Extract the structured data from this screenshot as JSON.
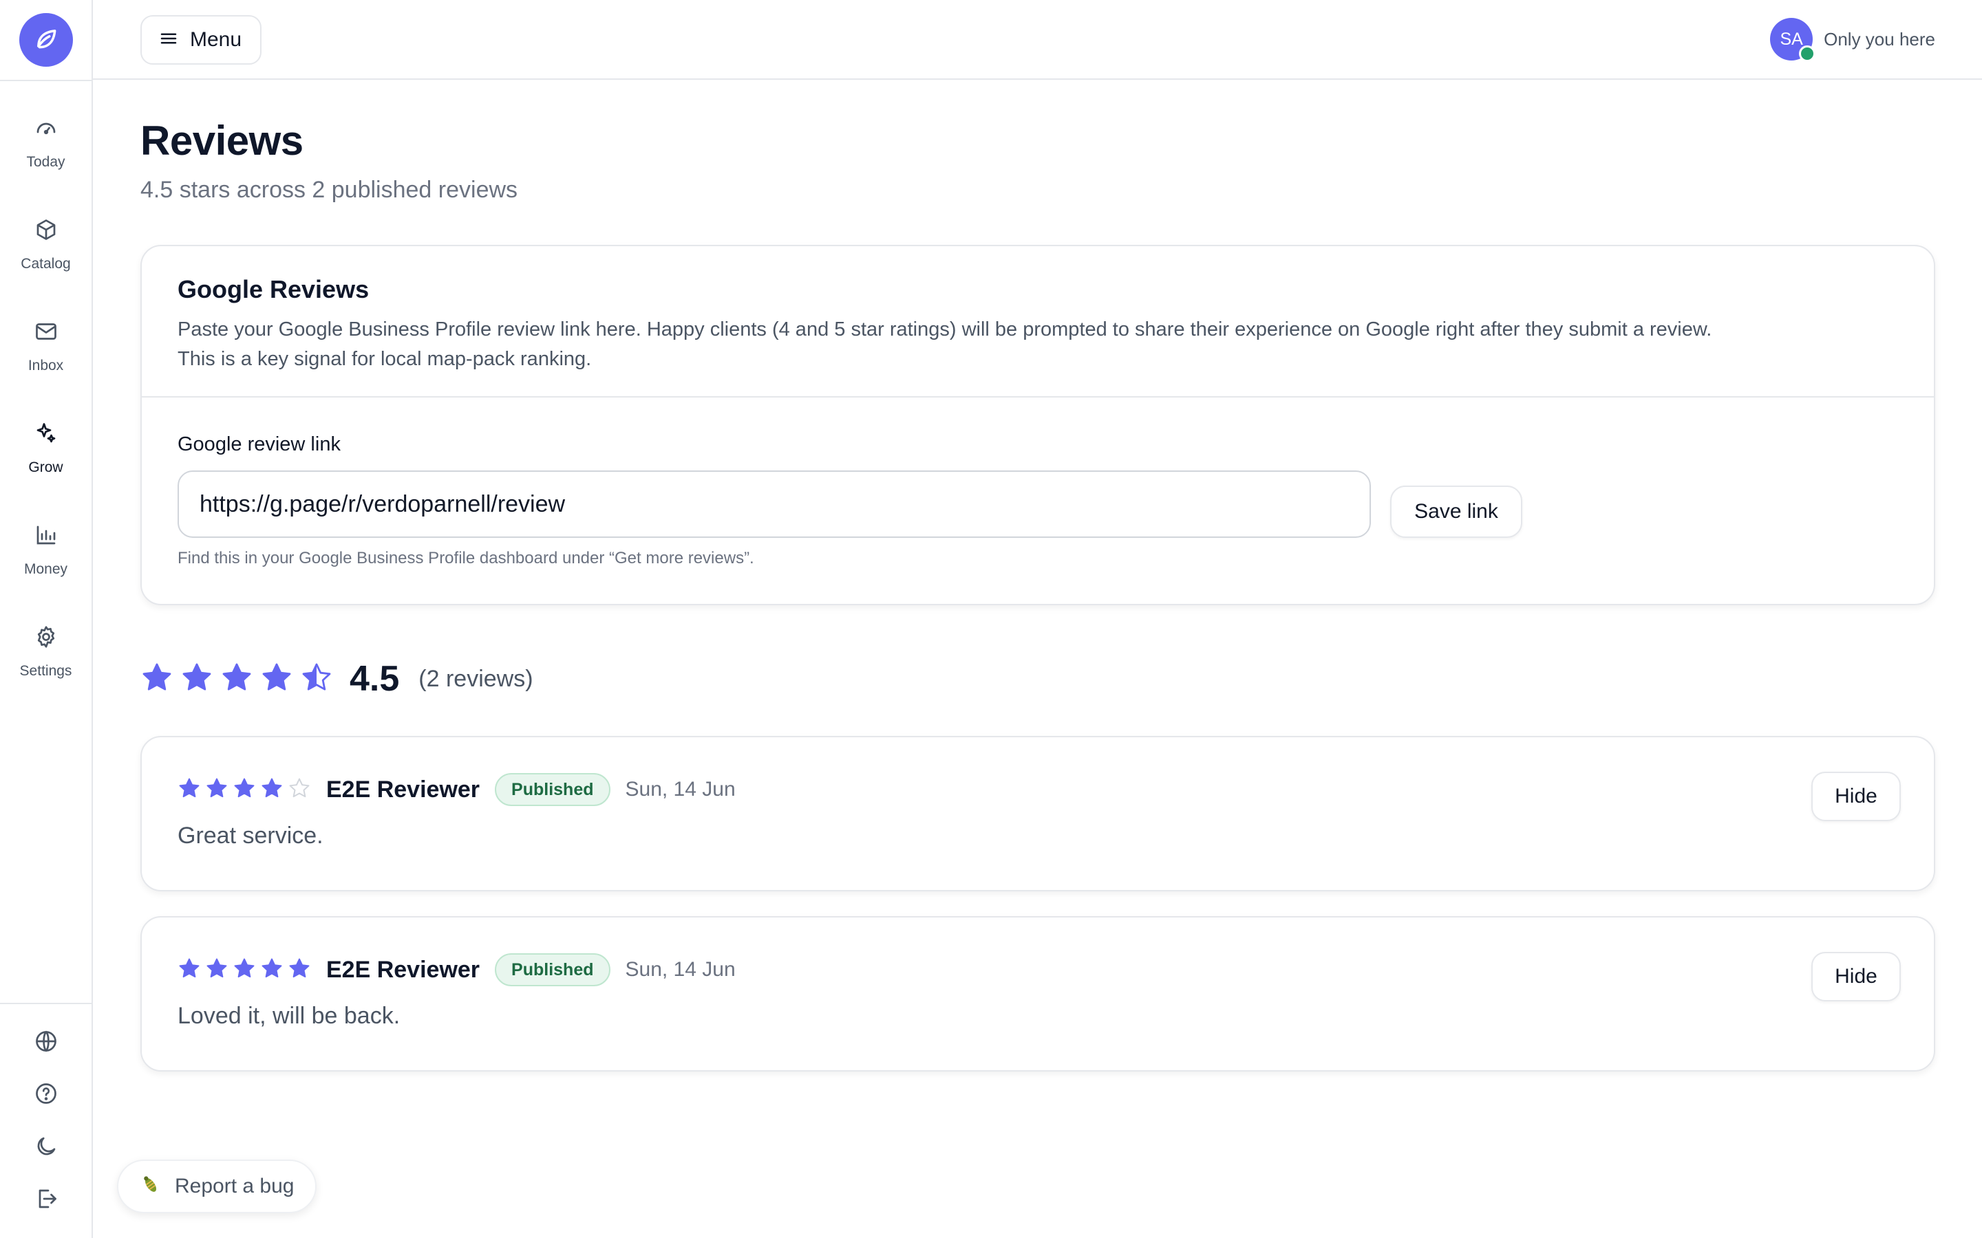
{
  "app": {
    "logo_icon": "leaf-icon",
    "accent_color": "#6366f1",
    "success_color": "#22a06b"
  },
  "sidebar": {
    "items": [
      {
        "label": "Today",
        "icon": "gauge-icon"
      },
      {
        "label": "Catalog",
        "icon": "box-icon"
      },
      {
        "label": "Inbox",
        "icon": "mail-icon"
      },
      {
        "label": "Grow",
        "icon": "sparkles-icon",
        "active": true
      },
      {
        "label": "Money",
        "icon": "bar-chart-icon"
      },
      {
        "label": "Settings",
        "icon": "gear-icon"
      }
    ],
    "bottom_icons": [
      "globe-icon",
      "help-icon",
      "moon-icon",
      "logout-icon"
    ]
  },
  "topbar": {
    "menu_label": "Menu",
    "user_initials": "SA",
    "presence_text": "Only you here"
  },
  "page": {
    "title": "Reviews",
    "subtitle": "4.5 stars across 2 published reviews"
  },
  "google": {
    "title": "Google Reviews",
    "description_line1": "Paste your Google Business Profile review link here. Happy clients (4 and 5 star ratings) will be prompted to share their experience on Google right after they submit a review.",
    "description_line2": "This is a key signal for local map-pack ranking.",
    "field_label": "Google review link",
    "field_value": "https://g.page/r/verdoparnell/review",
    "save_label": "Save link",
    "hint": "Find this in your Google Business Profile dashboard under “Get more reviews”."
  },
  "summary": {
    "rating": 4.5,
    "rating_text": "4.5",
    "count_text": "(2 reviews)"
  },
  "reviews": [
    {
      "rating": 4,
      "name": "E2E Reviewer",
      "status": "Published",
      "date": "Sun, 14 Jun",
      "text": "Great service.",
      "action": "Hide"
    },
    {
      "rating": 5,
      "name": "E2E Reviewer",
      "status": "Published",
      "date": "Sun, 14 Jun",
      "text": "Loved it, will be back.",
      "action": "Hide"
    }
  ],
  "bug_button": {
    "label": "Report a bug",
    "icon": "bug-icon"
  }
}
